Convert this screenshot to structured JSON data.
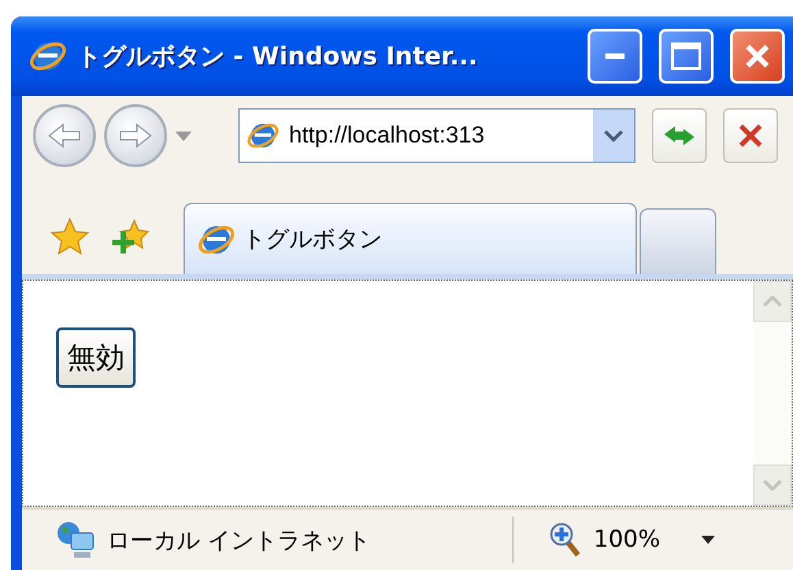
{
  "window": {
    "title": "トグルボタン - Windows Inter..."
  },
  "address_bar": {
    "value": "http://localhost:313"
  },
  "tabs": [
    {
      "label": "トグルボタン",
      "selected": true
    }
  ],
  "page": {
    "buttons": [
      {
        "label": "無効"
      }
    ]
  },
  "status_bar": {
    "zone": "ローカル イントラネット",
    "zoom": "100%"
  }
}
